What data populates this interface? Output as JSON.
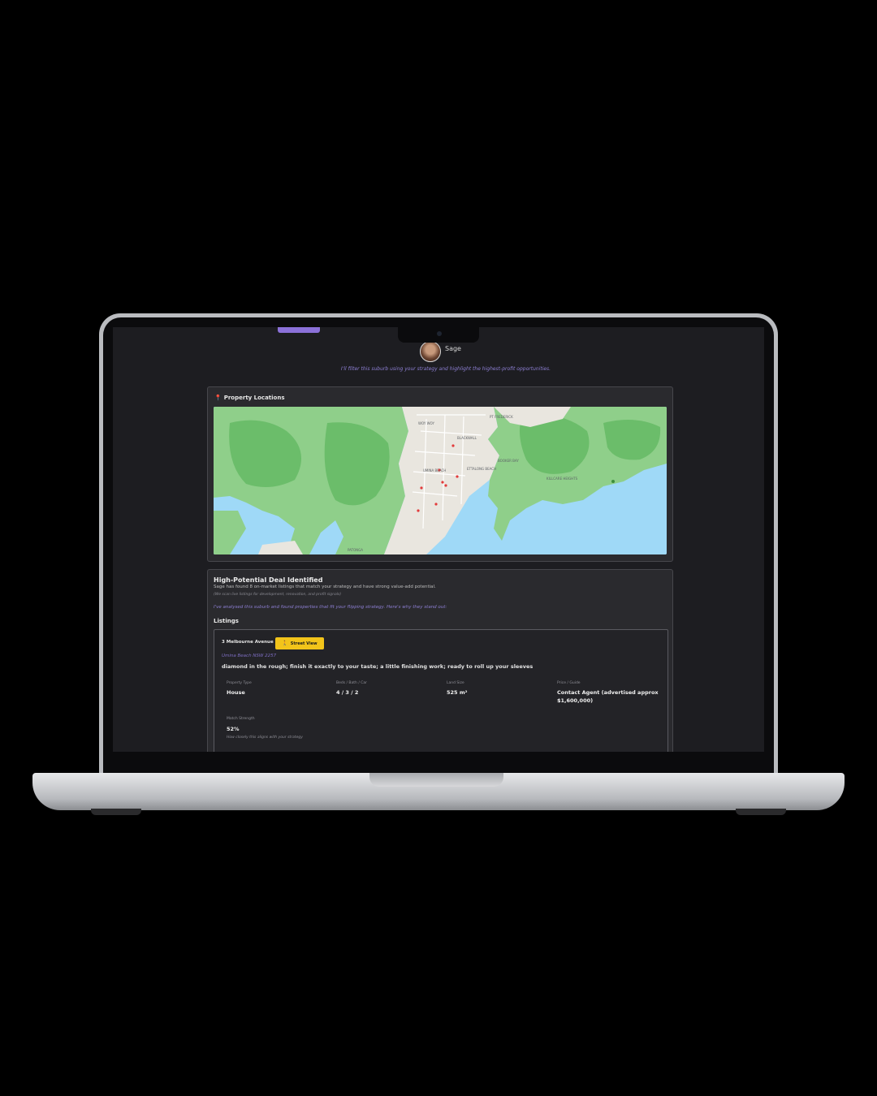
{
  "assistant": {
    "name": "Sage"
  },
  "intro_text": "I'll filter this suburb using your strategy and highlight the highest-profit opportunities.",
  "map_panel": {
    "title": "Property Locations",
    "icon": "map-pin-icon"
  },
  "deal": {
    "title": "High-Potential Deal Identified",
    "subtitle": "Sage has found 8 on-market listings that match your strategy and have strong value-add potential.",
    "note": "(We scan live listings for development, renovation, and profit signals)",
    "analysis": "I've analysed this suburb and found properties that fit your flipping strategy. Here's why they stand out:"
  },
  "listings_heading": "Listings",
  "listing": {
    "address": "3 Melbourne Avenue",
    "street_view_label": "Street View",
    "suburb": "Umina Beach NSW 2257",
    "tagline": "diamond in the rough; finish it exactly to your taste; a little finishing work; ready to roll up your sleeves",
    "specs": [
      {
        "label": "Property Type",
        "value": "House"
      },
      {
        "label": "Beds / Bath / Car",
        "value": "4 / 3 / 2"
      },
      {
        "label": "Land Size",
        "value": "525 m²"
      },
      {
        "label": "Price / Guide",
        "value": "Contact Agent (advertised approx $1,600,000)"
      }
    ],
    "match_label": "Match Strength",
    "match_value": "52%",
    "match_note": "How closely this aligns with your strategy"
  },
  "map_labels": [
    "ETTALONG BEACH",
    "UMINA BEACH",
    "WOY WOY",
    "BLACKWALL",
    "PATONGA",
    "BOOKER BAY",
    "KILLCARE HEIGHTS",
    "PT FREDERICK"
  ],
  "colors": {
    "accent": "#8b71d9",
    "button": "#f2c41a",
    "background": "#1d1d21"
  }
}
